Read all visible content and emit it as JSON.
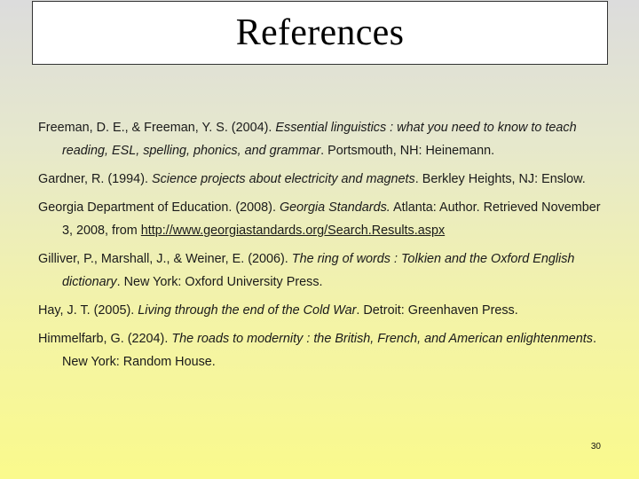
{
  "slide": {
    "title": "References",
    "page_number": "30"
  },
  "references": [
    {
      "before": "Freeman, D. E., & Freeman, Y. S. (2004). ",
      "work": "Essential linguistics : what you need to know to teach reading, ESL, spelling, phonics, and grammar",
      "after": ". Portsmouth, NH: Heinemann."
    },
    {
      "before": "Gardner, R. (1994). ",
      "work": "Science projects about electricity and magnets",
      "after": ". Berkley Heights, NJ: Enslow."
    },
    {
      "before": "Georgia Department of Education. (2008). ",
      "work": "Georgia Standards.",
      "after": " Atlanta: Author. Retrieved November 3, 2008, from ",
      "link": "http://www.georgiastandards.org/Search.Results.aspx"
    },
    {
      "before": "Gilliver, P., Marshall, J., & Weiner, E. (2006). ",
      "work": "The ring of words : Tolkien and the Oxford English dictionary",
      "after": ". New York: Oxford University Press."
    },
    {
      "before": "Hay, J. T. (2005). ",
      "work": "Living through the end of the Cold War",
      "after": ". Detroit: Greenhaven Press."
    },
    {
      "before": "Himmelfarb, G. (2204). ",
      "work": "The roads to modernity : the British, French, and American enlightenments",
      "after": ". New York: Random House."
    }
  ]
}
